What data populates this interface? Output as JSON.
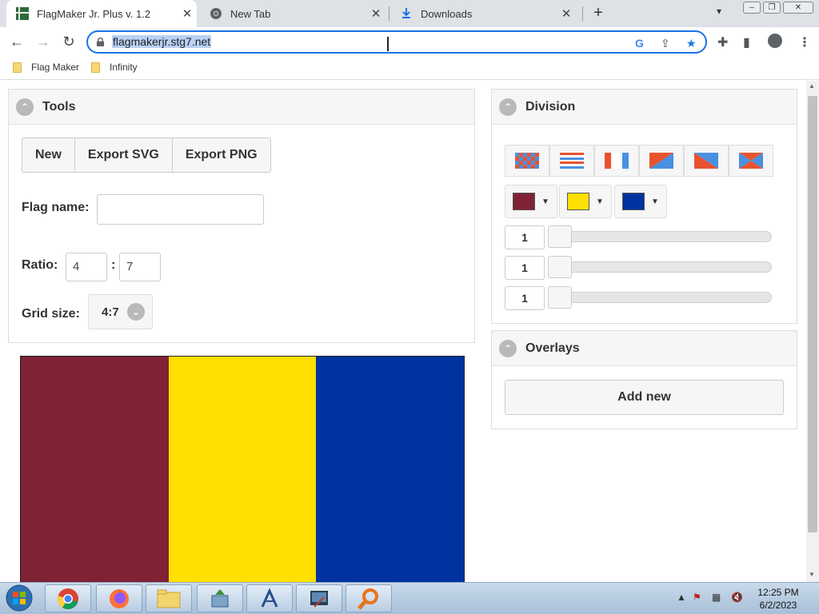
{
  "browser": {
    "tabs": [
      {
        "title": "FlagMaker Jr. Plus v. 1.2",
        "active": true
      },
      {
        "title": "New Tab",
        "active": false
      },
      {
        "title": "Downloads",
        "active": false
      }
    ],
    "url": "flagmakerjr.stg7.net",
    "bookmarks": [
      "Flag Maker",
      "Infinity"
    ]
  },
  "tools": {
    "title": "Tools",
    "buttons": [
      "New",
      "Export SVG",
      "Export PNG"
    ],
    "flag_name_label": "Flag name:",
    "flag_name_value": "",
    "ratio_label": "Ratio:",
    "ratio_height": "4",
    "ratio_sep": ":",
    "ratio_width": "7",
    "grid_label": "Grid size:",
    "grid_value": "4:7"
  },
  "division": {
    "title": "Division",
    "types": [
      "grid",
      "horizontal-stripes",
      "vertical-stripes",
      "diagonal-down",
      "diagonal-up",
      "x-cross"
    ],
    "colors": [
      "#7f2334",
      "#ffe000",
      "#0033a0"
    ],
    "sliders": [
      "1",
      "1",
      "1"
    ],
    "slider_levels": [
      0,
      0,
      0
    ]
  },
  "overlays": {
    "title": "Overlays",
    "add_label": "Add new"
  },
  "flag": {
    "stripes": [
      "#7f2334",
      "#ffe000",
      "#0033a0"
    ]
  },
  "taskbar": {
    "time": "12:25 PM",
    "date": "6/2/2023"
  }
}
